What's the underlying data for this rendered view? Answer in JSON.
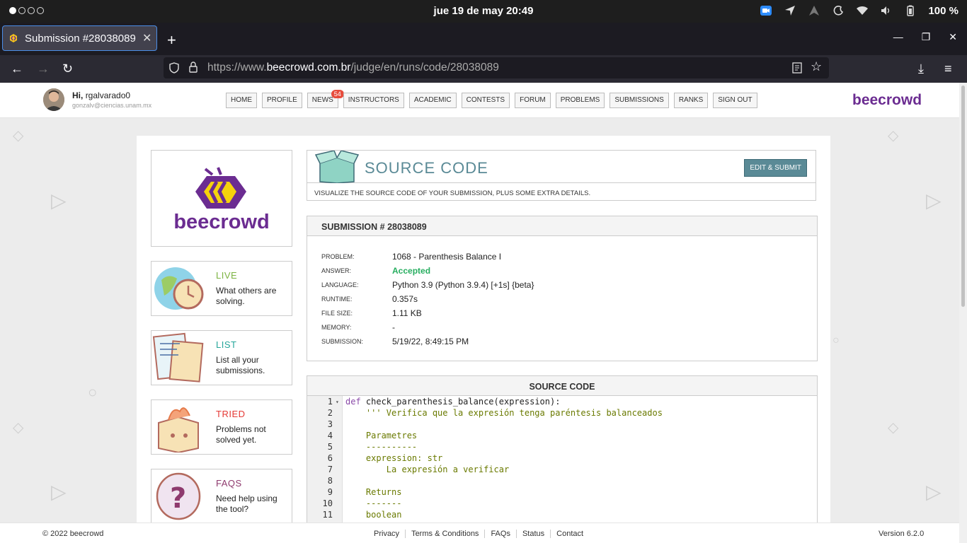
{
  "system": {
    "clock": "jue 19 de may  20:49",
    "battery": "100 %"
  },
  "browser": {
    "tab_title": "Submission #28038089 -",
    "url_prefix": "https://www.",
    "url_domain": "beecrowd.com.br",
    "url_path": "/judge/en/runs/code/28038089"
  },
  "user": {
    "greeting": "Hi,",
    "name": "rgalvarado0",
    "email": "gonzalv@ciencias.unam.mx"
  },
  "menu": [
    "HOME",
    "PROFILE",
    "NEWS",
    "INSTRUCTORS",
    "ACADEMIC",
    "CONTESTS",
    "FORUM",
    "PROBLEMS",
    "SUBMISSIONS",
    "RANKS",
    "SIGN OUT"
  ],
  "news_badge": "54",
  "brand": "beecrowd",
  "logo_word": "beecrowd",
  "side": [
    {
      "title": "LIVE",
      "desc": "What others are solving.",
      "color": "#7cb342"
    },
    {
      "title": "LIST",
      "desc": "List all your submissions.",
      "color": "#26a69a"
    },
    {
      "title": "TRIED",
      "desc": "Problems not solved yet.",
      "color": "#e53935"
    },
    {
      "title": "FAQS",
      "desc": "Need help using the tool?",
      "color": "#8e3a6e"
    }
  ],
  "source_header": {
    "title": "SOURCE CODE",
    "button": "EDIT & SUBMIT",
    "subtitle": "VISUALIZE THE SOURCE CODE OF YOUR SUBMISSION, PLUS SOME EXTRA DETAILS."
  },
  "submission": {
    "header": "SUBMISSION # 28038089",
    "rows": [
      {
        "k": "PROBLEM:",
        "v": "1068 - Parenthesis Balance I"
      },
      {
        "k": "ANSWER:",
        "v": "Accepted"
      },
      {
        "k": "LANGUAGE:",
        "v": "Python 3.9 (Python 3.9.4) [+1s] {beta}"
      },
      {
        "k": "RUNTIME:",
        "v": "0.357s"
      },
      {
        "k": "FILE SIZE:",
        "v": "1.11 KB"
      },
      {
        "k": "MEMORY:",
        "v": "-"
      },
      {
        "k": "SUBMISSION:",
        "v": "5/19/22, 8:49:15 PM"
      }
    ]
  },
  "code": {
    "header": "SOURCE CODE",
    "lines": [
      {
        "n": "1",
        "kw": "def",
        "fn": " check_parenthesis_balance(expression):",
        "t": ""
      },
      {
        "n": "2",
        "t": "    ''' Verifica que la expresión tenga paréntesis balanceados"
      },
      {
        "n": "3",
        "t": ""
      },
      {
        "n": "4",
        "t": "    Parametres"
      },
      {
        "n": "5",
        "t": "    ----------"
      },
      {
        "n": "6",
        "t": "    expression: str"
      },
      {
        "n": "7",
        "t": "        La expresión a verificar"
      },
      {
        "n": "8",
        "t": ""
      },
      {
        "n": "9",
        "t": "    Returns"
      },
      {
        "n": "10",
        "t": "    -------"
      },
      {
        "n": "11",
        "t": "    boolean"
      }
    ]
  },
  "footer": {
    "copy": "© 2022 beecrowd",
    "links": [
      "Privacy",
      "Terms & Conditions",
      "FAQs",
      "Status",
      "Contact"
    ],
    "version": "Version 6.2.0"
  }
}
